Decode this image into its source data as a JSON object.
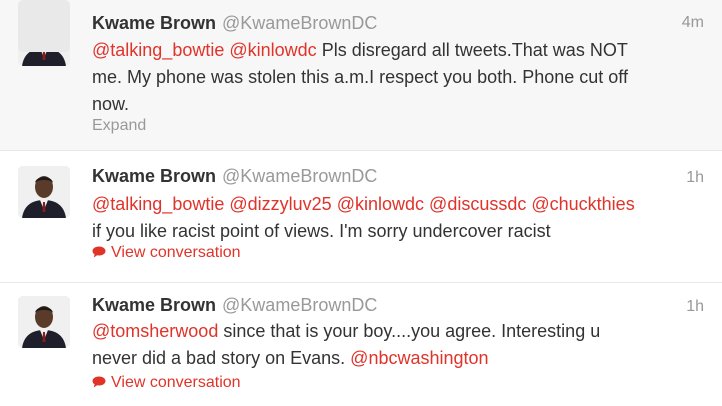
{
  "tweets": [
    {
      "name": "Kwame Brown",
      "handle": "@KwameBrownDC",
      "time": "4m",
      "mentions_line1": [
        "@talking_bowtie",
        "@kinlowdc"
      ],
      "text_line1": "Pls disregard all tweets.That was NOT",
      "text_line2": "me. My phone was stolen this a.m.I respect you both. Phone cut off",
      "text_line3": "now.",
      "action": "Expand"
    },
    {
      "name": "Kwame Brown",
      "handle": "@KwameBrownDC",
      "time": "1h",
      "mentions": [
        "@talking_bowtie",
        "@dizzyluv25",
        "@kinlowdc",
        "@discussdc",
        "@chuckthies"
      ],
      "text_line2": "if you like racist point of views. I'm sorry undercover racist",
      "action": "View conversation",
      "action_icon": "speech-bubble-icon"
    },
    {
      "name": "Kwame Brown",
      "handle": "@KwameBrownDC",
      "time": "1h",
      "mention_start": "@tomsherwood",
      "text_line1": "since that is your boy....you agree. Interesting u",
      "text_line2": "never did a bad story on Evans.",
      "mention_end": "@nbcwashington",
      "action": "View conversation",
      "action_icon": "speech-bubble-icon"
    }
  ],
  "colors": {
    "mention": "#e0332a",
    "muted": "#999999",
    "text": "#333333",
    "highlight_bg": "#f7f7f7"
  }
}
